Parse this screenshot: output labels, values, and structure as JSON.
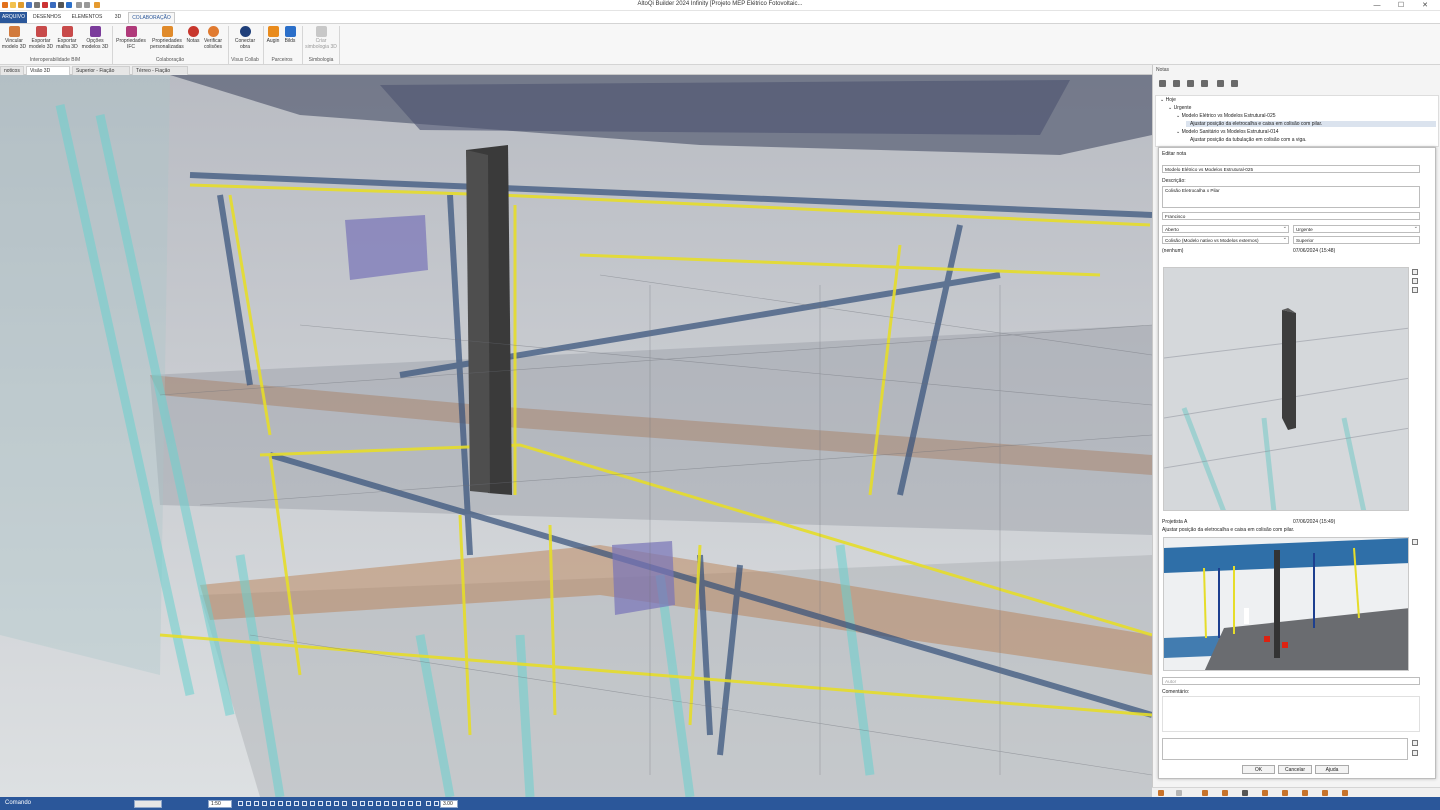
{
  "window": {
    "title": "AltoQi Builder 2024 Infinity [Projeto MEP Elétrico Fotovoltaic...",
    "min": "—",
    "max": "☐",
    "close": "✕"
  },
  "ribbon_tabs": [
    "ARQUIVO",
    "DESENHOS",
    "ELEMENTOS",
    "3D",
    "COLABORAÇÃO"
  ],
  "ribbon": {
    "buttons": [
      {
        "l1": "Vincular",
        "l2": "modelo 3D",
        "color": "#d27a3c"
      },
      {
        "l1": "Exportar",
        "l2": "modelo 3D",
        "color": "#c84a4a"
      },
      {
        "l1": "Exportar",
        "l2": "malha 3D",
        "color": "#c84a4a"
      },
      {
        "l1": "Opções",
        "l2": "modelos 3D",
        "color": "#7b3c9b"
      },
      {
        "l1": "Propriedades",
        "l2": "IFC",
        "color": "#b03a7a"
      },
      {
        "l1": "Propriedades",
        "l2": "personalizadas",
        "color": "#e08a2a"
      },
      {
        "l1": "Notas",
        "l2": "",
        "color": "#c8372d"
      },
      {
        "l1": "Verificar",
        "l2": "colisões",
        "color": "#e07a30"
      },
      {
        "l1": "Conectar",
        "l2": "obra",
        "color": "#1f3f7a"
      },
      {
        "l1": "Augin",
        "l2": "",
        "color": "#e98b1c"
      },
      {
        "l1": "Bilds",
        "l2": "",
        "color": "#2b6fc9"
      },
      {
        "l1": "Criar",
        "l2": "simbologia 3D",
        "color": "#b7b7b7"
      }
    ],
    "groups": [
      "Interoperabilidade BIM",
      "Colaboração",
      "Visus Collab",
      "Parceiros",
      "Simbologia"
    ]
  },
  "doc_tabs": [
    "noticos",
    "Visão 3D",
    "Superior - Fiação",
    "Térreo - Fiação"
  ],
  "notes": {
    "panel_title": "Notas",
    "tree": {
      "today": "Hoje",
      "priority": "Urgente",
      "note1": "Modelo Elétrico vs Modelos Estrutural-025",
      "note1_desc": "Ajustar posição da eletrocalha e caixa em colisão com pilar.",
      "note2": "Modelo Sanitário vs Modelos Estrutural-014",
      "note2_desc": "Ajustar posição da tubulação em colisão com a viga."
    },
    "dialog": {
      "title": "Editar nota",
      "name_value": "Modelo Elétrico vs Modelos Estrutural-025",
      "description_label": "Descrição:",
      "description_value": "Colisão Eletrocalha x Pilar",
      "author_value": "Francisco",
      "status": "Aberto",
      "priority": "Urgente",
      "type": "Colisão (Modelo nativo vs Modelos externos)",
      "floor": "Superior",
      "none": "(nenhum)",
      "date": "07/06/2024 (15:48)",
      "comment_author": "Projetista A",
      "comment_date": "07/06/2024 (15:49)",
      "comment_text": "Ajustar posição da eletrocalha e caixa em colisão com pilar.",
      "author_placeholder": "Autor",
      "comment_label": "Comentário:",
      "ok": "OK",
      "cancel": "Cancelar",
      "help": "Ajuda"
    }
  },
  "statusbar": {
    "command_label": "Comando",
    "scale": "1:50",
    "zoom": "3.00"
  },
  "colors": {
    "accent": "#2b579a",
    "conduit": "#e6dd2a",
    "pillar": "#3a3a3a"
  }
}
